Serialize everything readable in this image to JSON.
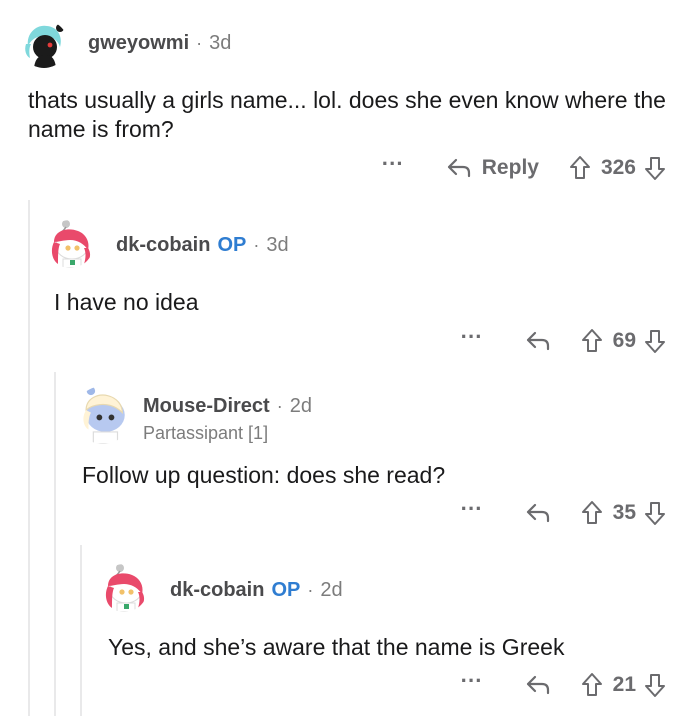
{
  "comments": [
    {
      "username": "gweyowmi",
      "op": "",
      "separator": "·",
      "time": "3d",
      "flair": "",
      "body": "thats usually a girls name... lol. does she even know where the name is from?",
      "more": "···",
      "reply_label": "Reply",
      "score": "326"
    },
    {
      "username": "dk-cobain",
      "op": "OP",
      "separator": "·",
      "time": "3d",
      "flair": "",
      "body": "I have no idea",
      "more": "···",
      "reply_label": "",
      "score": "69"
    },
    {
      "username": "Mouse-Direct",
      "op": "",
      "separator": "·",
      "time": "2d",
      "flair": "Partassipant [1]",
      "body": "Follow up question: does she read?",
      "more": "···",
      "reply_label": "",
      "score": "35"
    },
    {
      "username": "dk-cobain",
      "op": "OP",
      "separator": "·",
      "time": "2d",
      "flair": "",
      "body": "Yes, and she’s aware that the name is Greek",
      "more": "···",
      "reply_label": "",
      "score": "21"
    }
  ],
  "colors": {
    "op_accent": "#2f7dd1",
    "meta_gray": "#7c7c7c",
    "action_gray": "#6b6b6e",
    "thread_line": "#e9e9ea"
  }
}
